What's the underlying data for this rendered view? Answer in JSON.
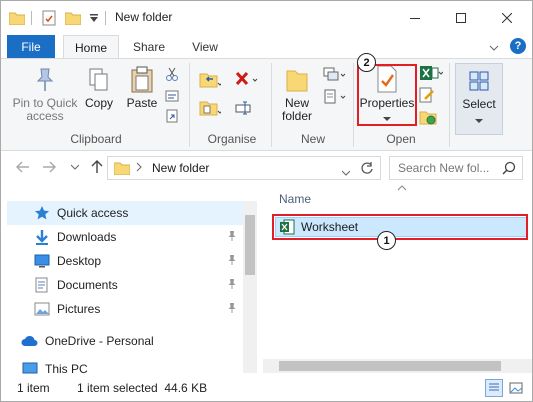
{
  "window": {
    "title": "New folder",
    "controls": [
      "minimize",
      "maximize",
      "close"
    ]
  },
  "ribbon_tabs": [
    {
      "label": "File",
      "active": false
    },
    {
      "label": "Home",
      "active": true
    },
    {
      "label": "Share",
      "active": false
    },
    {
      "label": "View",
      "active": false
    }
  ],
  "ribbon": {
    "clipboard": {
      "pin_label": "Pin to Quick access",
      "copy_label": "Copy",
      "paste_label": "Paste",
      "group_label": "Clipboard"
    },
    "organise": {
      "group_label": "Organise"
    },
    "new": {
      "new_folder_label": "New folder",
      "group_label": "New"
    },
    "open": {
      "properties_label": "Properties",
      "group_label": "Open"
    },
    "select": {
      "select_label": "Select"
    }
  },
  "address": {
    "path": "New folder",
    "search_placeholder": "Search New fol..."
  },
  "nav_pane": {
    "items": [
      {
        "label": "Quick access",
        "icon": "star-icon",
        "selected": true,
        "pinned": false
      },
      {
        "label": "Downloads",
        "icon": "download-icon",
        "selected": false,
        "pinned": true
      },
      {
        "label": "Desktop",
        "icon": "desktop-icon",
        "selected": false,
        "pinned": true
      },
      {
        "label": "Documents",
        "icon": "documents-icon",
        "selected": false,
        "pinned": true
      },
      {
        "label": "Pictures",
        "icon": "pictures-icon",
        "selected": false,
        "pinned": true
      },
      {
        "label": "OneDrive - Personal",
        "icon": "cloud-icon",
        "selected": false,
        "pinned": false
      },
      {
        "label": "This PC",
        "icon": "pc-icon",
        "selected": false,
        "pinned": false
      }
    ]
  },
  "content": {
    "column_header": "Name",
    "files": [
      {
        "name": "Worksheet",
        "icon": "excel-file-icon",
        "selected": true
      }
    ]
  },
  "status": {
    "item_count": "1 item",
    "selection": "1 item selected  44.6 KB"
  },
  "callouts": [
    {
      "number": "1",
      "target": "Worksheet"
    },
    {
      "number": "2",
      "target": "Properties"
    }
  ],
  "colors": {
    "accent": "#1a6fc4",
    "highlight": "#e31e24",
    "selection": "#cce8ff",
    "excel_green": "#1e7145",
    "folder_yellow": "#f8d775"
  }
}
